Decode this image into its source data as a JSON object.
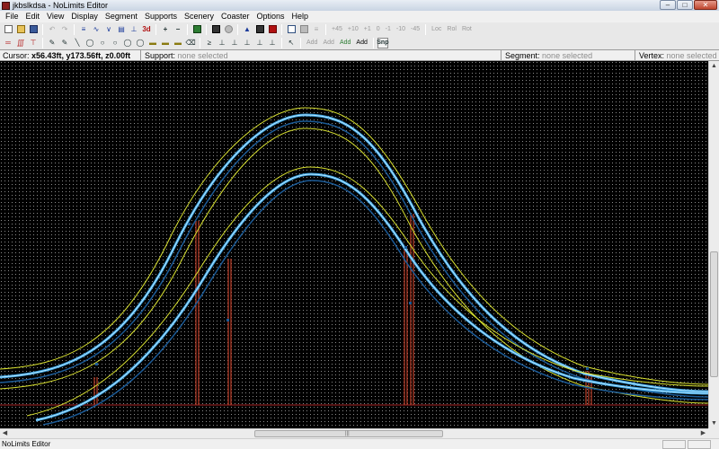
{
  "window": {
    "title": "jkbslkdsa - NoLimits Editor",
    "controls": [
      "minimize",
      "maximize",
      "close"
    ]
  },
  "menu": [
    "File",
    "Edit",
    "View",
    "Display",
    "Segment",
    "Supports",
    "Scenery",
    "Coaster",
    "Options",
    "Help"
  ],
  "toolbar1": {
    "view_3d_label": "3d",
    "rotation_labels": [
      "+45",
      "+10",
      "+1",
      "0",
      "-1",
      "-10",
      "-45"
    ],
    "mode_labels": [
      "Loc",
      "Rol",
      "Rot"
    ]
  },
  "toolbar2": {
    "add_labels": [
      "Add",
      "Add",
      "Add",
      "Add"
    ],
    "snap_label": "Snp"
  },
  "infobar": {
    "cursor_label": "Cursor:",
    "cursor_value": "x56.43ft, y173.56ft, z0.00ft",
    "support_label": "Support:",
    "support_value": "none selected",
    "segment_label": "Segment:",
    "segment_value": "none selected",
    "vertex_label": "Vertex:",
    "vertex_value": "none selected"
  },
  "canvas": {
    "background": "#000000",
    "grid_dot_color": "#8c8c8c",
    "rail_color": "#3aa0e0",
    "rail_highlight_color": "#b8e8ff",
    "spine_color": "#1b5a96",
    "guide_color": "#d8e030",
    "support_color": "#c0402a",
    "ground_color": "#8a1e1e"
  },
  "statusbar": {
    "text": "NoLimits Editor"
  }
}
